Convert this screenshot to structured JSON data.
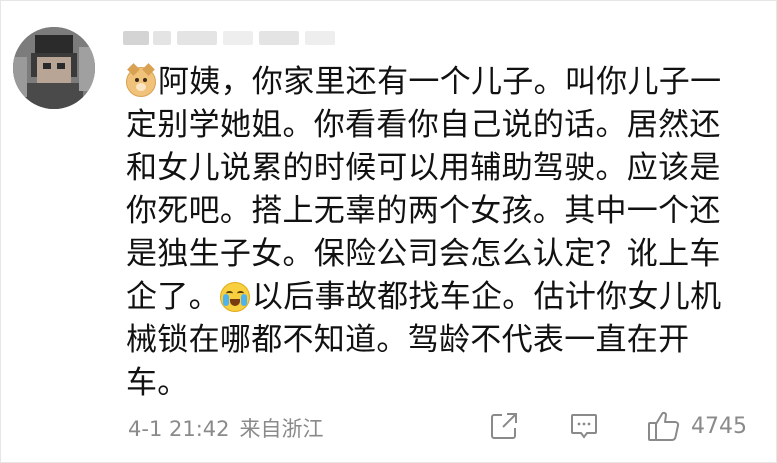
{
  "comment": {
    "emojis": {
      "first": "doge-icon",
      "second": "laugh-cry-icon"
    },
    "text_part1": "阿姨，你家里还有一个儿子。叫你儿子一定别学她姐。你看看你自己说的话。居然还和女儿说累的时候可以用辅助驾驶。应该是你死吧。搭上无辜的两个女孩。其中一个还是独生子女。保险公司会怎么认定？讹上车企了。",
    "text_part2": "以后事故都找车企。估计你女儿机械锁在哪都不知道。驾龄不代表一直在开车。"
  },
  "footer": {
    "timestamp": "4-1 21:42",
    "location": "来自浙江",
    "like_count": "4745"
  },
  "colors": {
    "text": "#111111",
    "meta": "#8a8a8a",
    "background": "#ffffff"
  }
}
